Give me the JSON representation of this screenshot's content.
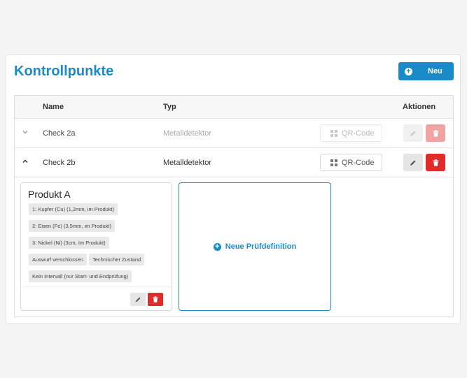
{
  "page": {
    "title": "Kontrollpunkte",
    "new_button_label": "Neu"
  },
  "table": {
    "headers": {
      "name": "Name",
      "typ": "Typ",
      "aktionen": "Aktionen"
    },
    "rows": [
      {
        "name": "Check 2a",
        "typ": "Metalldetektor",
        "qr_label": "QR-Code",
        "expanded": false
      },
      {
        "name": "Check 2b",
        "typ": "Metalldetektor",
        "qr_label": "QR-Code",
        "expanded": true
      }
    ]
  },
  "expanded": {
    "card": {
      "title": "Produkt A",
      "tags": [
        "1: Kupfer (Cu) (1,2mm, im Produkt)",
        "2: Eisen (Fe) (3,5mm, im Produkt)",
        "3: Nickel (Ni) (3cm, Im Produkt)",
        "Auswurf verschlossen",
        "Technischer Zustand",
        "Kein Intervall (nur Start- und Endprüfung)"
      ]
    },
    "new_definition_label": "Neue Prüfdefinition"
  },
  "colors": {
    "accent": "#1a8bc9",
    "danger": "#e02b2b"
  },
  "icons": {
    "collapsed_row": "chevron-down-icon",
    "expanded_row": "chevron-up-icon",
    "qr": "qr-code-icon",
    "edit": "pencil-icon",
    "delete": "trash-icon",
    "add": "plus-circle-icon"
  }
}
